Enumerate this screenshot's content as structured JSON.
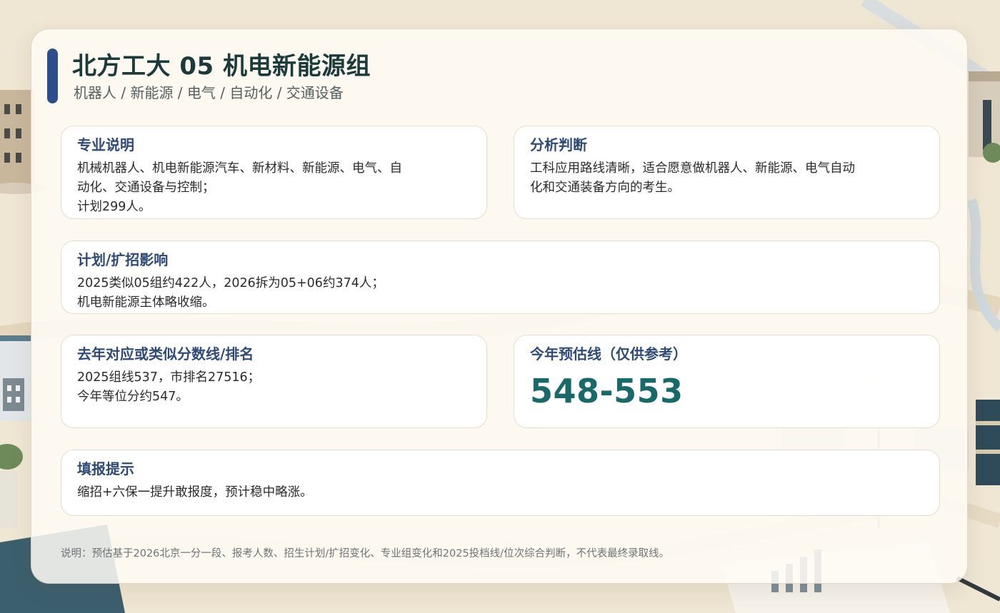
{
  "header": {
    "title": "北方工大 05 机电新能源组",
    "subtitle": "机器人 / 新能源 / 电气 / 自动化 / 交通设备"
  },
  "major_description": {
    "label": "专业说明",
    "text": "机械机器人、机电新能源汽车、新材料、新能源、电气、自\n动化、交通设备与控制；\n计划299人。"
  },
  "analysis": {
    "label": "分析判断",
    "text": "工科应用路线清晰，适合愿意做机器人、新能源、电气自动\n化和交通装备方向的考生。"
  },
  "plan_impact": {
    "label": "计划/扩招影响",
    "text": "2025类似05组约422人，2026拆为05+06约374人；\n机电新能源主体略收缩。"
  },
  "last_year_score": {
    "label": "去年对应或类似分数线/排名",
    "text": "2025组线537，市排名27516；\n今年等位分约547。"
  },
  "estimate": {
    "label": "今年预估线（仅供参考）",
    "value": "548-553"
  },
  "tips": {
    "label": "填报提示",
    "text": "缩招+六保一提升敢报度，预计稳中略涨。"
  },
  "footnote": "说明：预估基于2026北京一分一段、报考人数、招生计划/扩招变化、专业组变化和2025投档线/位次综合判断，不代表最终录取线。",
  "colors": {
    "accent": "#2c4f8c",
    "label": "#2d4a78",
    "estimate": "#186a6a",
    "title": "#1b3a3a"
  }
}
